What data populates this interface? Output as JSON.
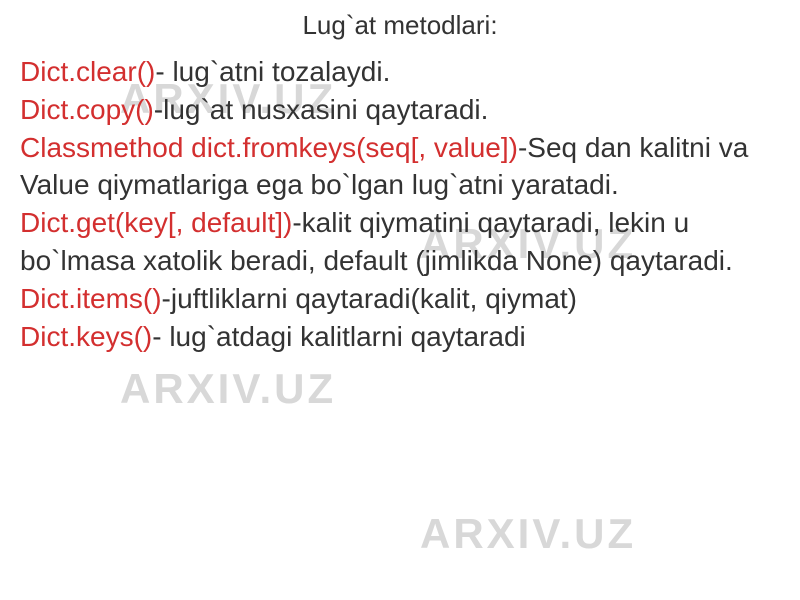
{
  "watermark": "ARXIV.UZ",
  "title": "Lug`at metodlari:",
  "lines": {
    "l1_method": "Dict.clear()",
    "l1_desc": "- lug`atni tozalaydi.",
    "l2_method": "Dict.copy()",
    "l2_desc": "-lug`at nusxasini qaytaradi.",
    "l3_method": "Classmethod dict.fromkeys(seq[, value])",
    "l3_desc": "-Seq dan kalitni va Value qiymatlariga ega bo`lgan lug`atni yaratadi.",
    "l4_method": "Dict.get(key[, default])",
    "l4_desc": "-kalit qiymatini qaytaradi, lekin u bo`lmasa xatolik beradi, default (jimlikda None) qaytaradi.",
    "l5_method": "Dict.items()",
    "l5_desc": "-juftliklarni qaytaradi(kalit, qiymat)",
    "l6_method": "Dict.keys()",
    "l6_desc": "- lug`atdagi kalitlarni qaytaradi"
  }
}
